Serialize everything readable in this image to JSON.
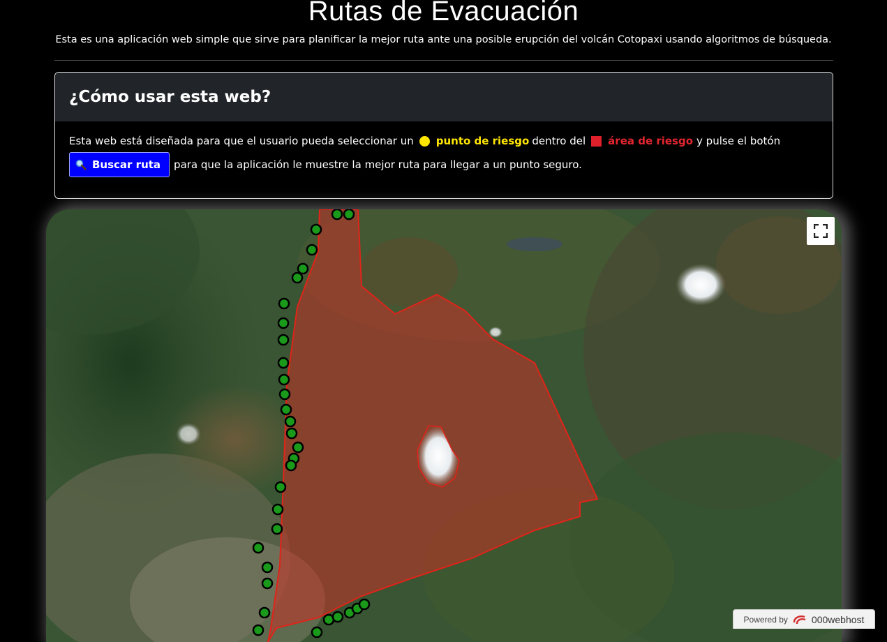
{
  "header": {
    "title": "Rutas de Evacuación",
    "subtitle": "Esta es una aplicación web simple que sirve para planificar la mejor ruta ante una posible erupción del volcán Cotopaxi usando algoritmos de búsqueda."
  },
  "help_card": {
    "heading": "¿Cómo usar esta web?",
    "text_part1": "Esta web está diseñada para que el usuario pueda seleccionar un",
    "risk_point_label": "punto de riesgo",
    "text_part2": "dentro del",
    "risk_area_label": "área de riesgo",
    "text_part3": "y pulse el botón",
    "button_label": "Buscar ruta",
    "text_part4": "para que la aplicación le muestre la mejor ruta para llegar a un punto seguro."
  },
  "map": {
    "fullscreen_icon": "fullscreen-icon",
    "risk_area_color": "#c83226",
    "safe_point_color": "#1a9a1a",
    "risk_point_color": "#ffe600"
  },
  "footer": {
    "powered_by": "Powered by",
    "host_name": "000webhost"
  }
}
